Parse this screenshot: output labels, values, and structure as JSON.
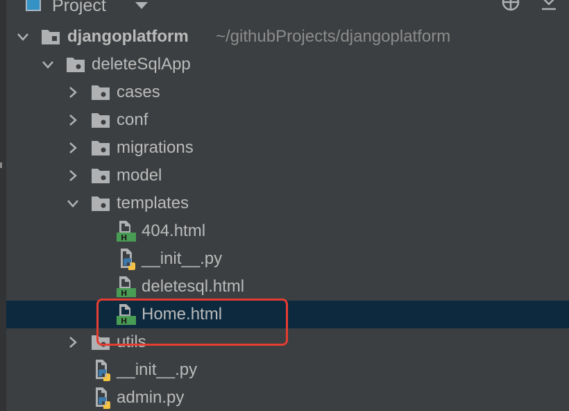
{
  "toolbar": {
    "title": "Project",
    "icons": [
      "project-view-icon",
      "dropdown-icon",
      "locate-icon",
      "collapse-all-icon"
    ]
  },
  "tree": {
    "root": {
      "label": "djangoplatform",
      "path": "~/githubProjects/djangoplatform",
      "expanded": true
    },
    "items": [
      {
        "label": "deleteSqlApp",
        "type": "folder",
        "expanded": true
      },
      {
        "label": "cases",
        "type": "folder",
        "expanded": false
      },
      {
        "label": "conf",
        "type": "folder",
        "expanded": false
      },
      {
        "label": "migrations",
        "type": "folder",
        "expanded": false
      },
      {
        "label": "model",
        "type": "folder",
        "expanded": false
      },
      {
        "label": "templates",
        "type": "folder",
        "expanded": true
      },
      {
        "label": "404.html",
        "type": "html-file"
      },
      {
        "label": "__init__.py",
        "type": "python-file"
      },
      {
        "label": "deletesql.html",
        "type": "html-file"
      },
      {
        "label": "Home.html",
        "type": "html-file",
        "selected": true
      },
      {
        "label": "utils",
        "type": "folder",
        "expanded": false
      },
      {
        "label": "__init__.py",
        "type": "python-file"
      },
      {
        "label": "admin.py",
        "type": "python-file"
      }
    ]
  },
  "colors": {
    "background": "#3c3f41",
    "selection": "#0d293e",
    "text": "#bbbbbb",
    "path_text": "#8c8c8c",
    "annotation_box": "#e53d32",
    "html_icon_green": "#499c54",
    "python_blue": "#3c78aa",
    "python_yellow": "#f5c342"
  }
}
